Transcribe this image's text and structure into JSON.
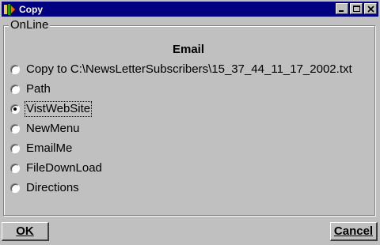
{
  "window": {
    "title": "Copy"
  },
  "group": {
    "legend": "OnLine",
    "heading": "Email"
  },
  "options": [
    {
      "label": "Copy to C:\\NewsLetterSubscribers\\15_37_44_11_17_2002.txt",
      "selected": false
    },
    {
      "label": "Path",
      "selected": false
    },
    {
      "label": "VistWebSite",
      "selected": true
    },
    {
      "label": "NewMenu",
      "selected": false
    },
    {
      "label": "EmailMe",
      "selected": false
    },
    {
      "label": "FileDownLoad",
      "selected": false
    },
    {
      "label": "Directions",
      "selected": false
    }
  ],
  "buttons": {
    "ok": "OK",
    "cancel": "Cancel"
  },
  "colors": {
    "titlebar": "#000080",
    "face": "#c0c0c0"
  },
  "icons": {
    "app": "app-icon",
    "minimize": "minimize-icon",
    "maximize": "maximize-icon",
    "close": "close-icon"
  }
}
